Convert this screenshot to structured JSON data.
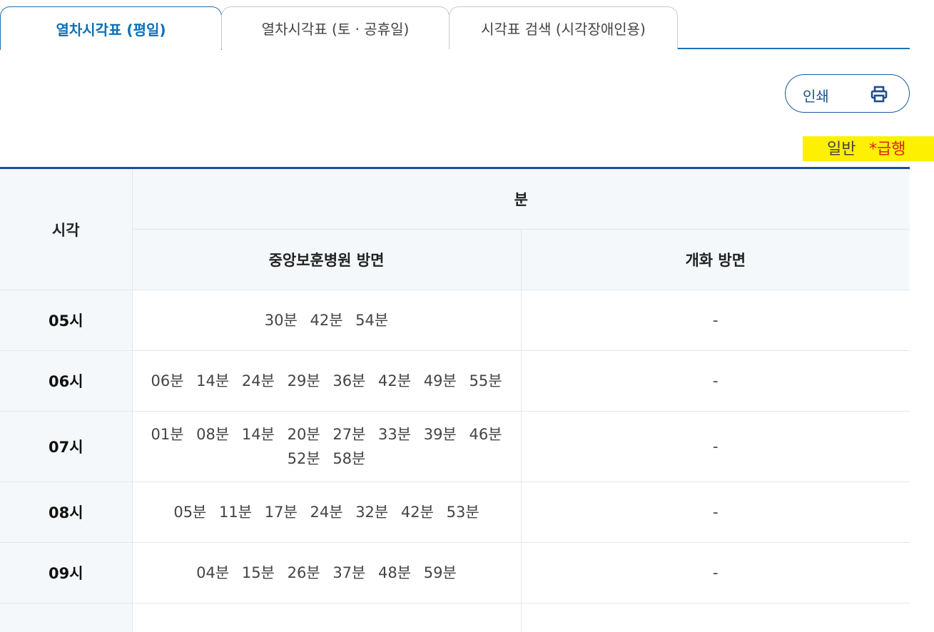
{
  "tabs": [
    {
      "label": "열차시각표 (평일)",
      "active": true
    },
    {
      "label": "열차시각표 (토 · 공휴일)",
      "active": false
    },
    {
      "label": "시각표 검색 (시각장애인용)",
      "active": false
    }
  ],
  "print_button": {
    "label": "인쇄",
    "icon": "printer-icon"
  },
  "legend": {
    "normal": "일반",
    "rapid": "*급행"
  },
  "table": {
    "header_time": "시각",
    "header_minutes": "분",
    "direction_1": "중앙보훈병원 방면",
    "direction_2": "개화 방면",
    "rows": [
      {
        "hour": "05시",
        "dir1": "30분 42분 54분",
        "dir2": "-"
      },
      {
        "hour": "06시",
        "dir1": "06분 14분 24분 29분 36분 42분 49분 55분",
        "dir2": "-"
      },
      {
        "hour": "07시",
        "dir1": "01분 08분 14분 20분 27분 33분 39분 46분 52분 58분",
        "dir2": "-"
      },
      {
        "hour": "08시",
        "dir1": "05분 11분 17분 24분 32분 42분 53분",
        "dir2": "-"
      },
      {
        "hour": "09시",
        "dir1": "04분 15분 26분 37분 48분 59분",
        "dir2": "-"
      }
    ]
  },
  "colors": {
    "accent": "#0b6fb8",
    "table_top_border": "#1a4f9c",
    "legend_bg": "#fdf000",
    "rapid": "#d9261c"
  }
}
